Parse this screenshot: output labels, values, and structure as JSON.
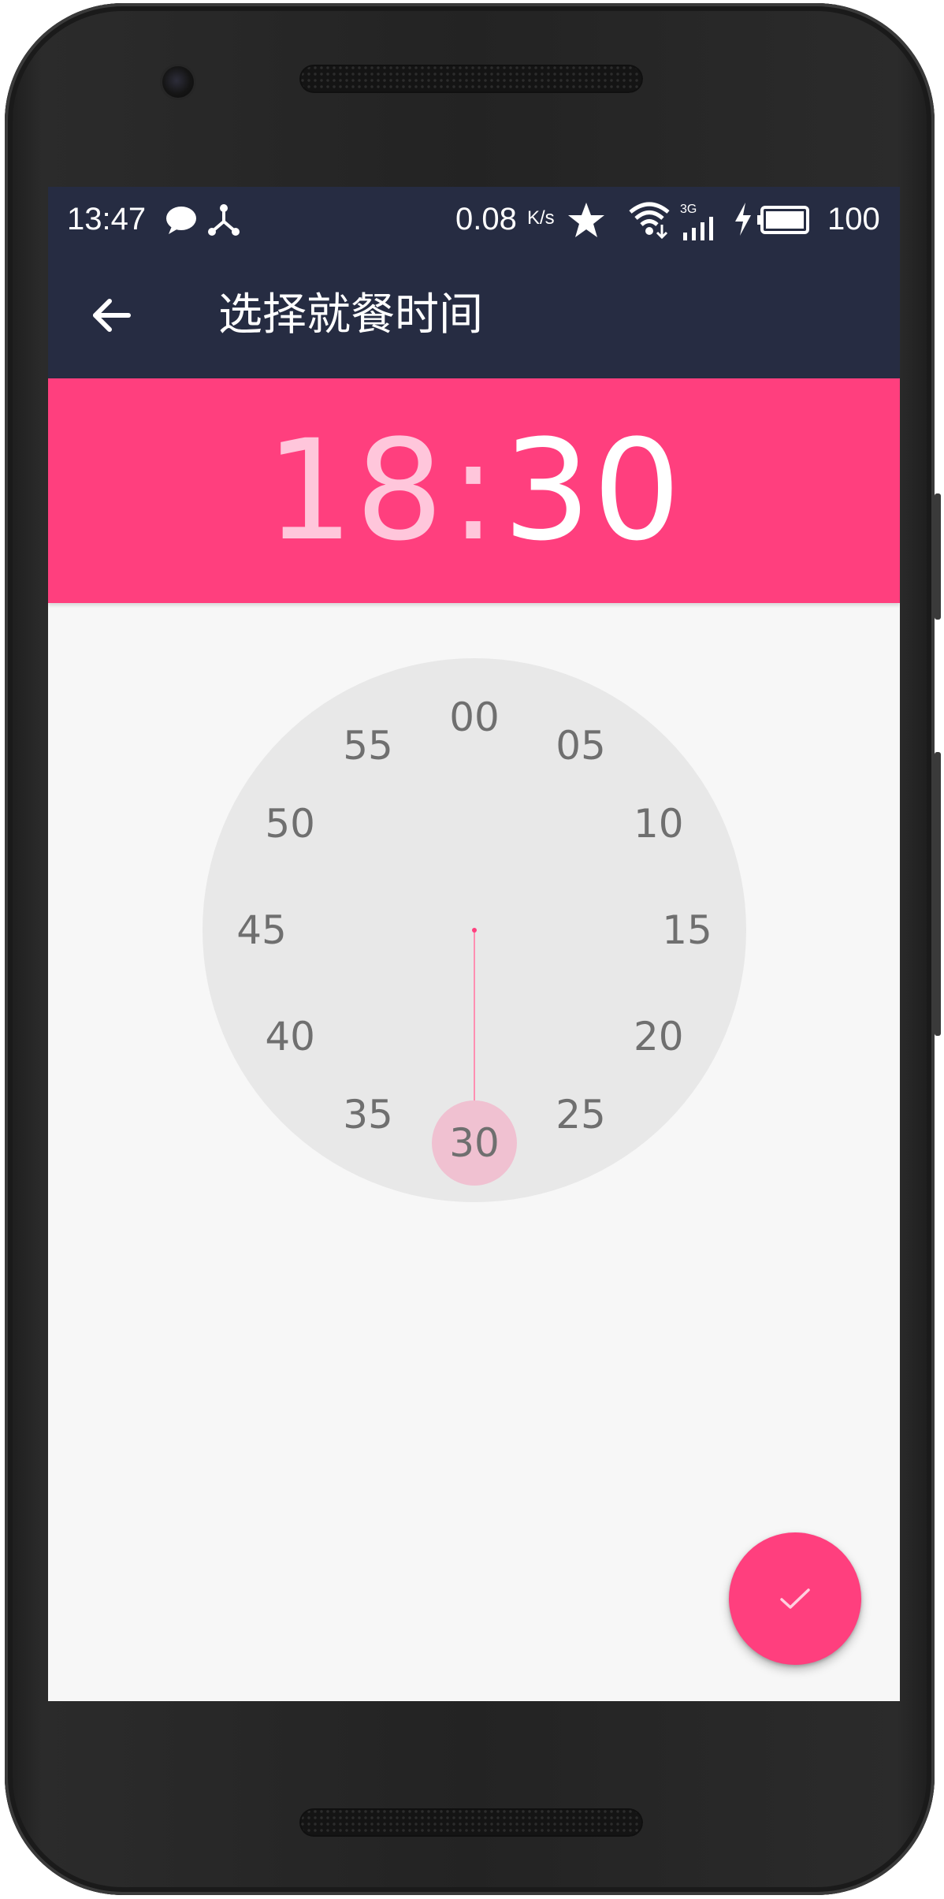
{
  "status_bar": {
    "time": "13:47",
    "speed_value": "0.08",
    "speed_unit": "K/s",
    "network_type": "3G",
    "battery": "100",
    "icons": [
      "chat-bubble-icon",
      "usb-share-icon",
      "star-icon",
      "wifi-icon",
      "signal-icon",
      "charging-icon",
      "battery-icon"
    ]
  },
  "app_bar": {
    "title": "选择就餐时间",
    "back_icon": "arrow-left-icon"
  },
  "time_header": {
    "hour": "18",
    "separator": ":",
    "minute": "30",
    "active_field": "minute"
  },
  "clock": {
    "labels": [
      "00",
      "05",
      "10",
      "15",
      "20",
      "25",
      "30",
      "35",
      "40",
      "45",
      "50",
      "55"
    ],
    "selected": "30"
  },
  "fab": {
    "icon": "check-icon"
  },
  "colors": {
    "app_bar": "#262c42",
    "accent": "#ff3f7e",
    "inactive_time": "#ffc6db",
    "clock_face": "#e8e8e8",
    "clock_selection": "#f0c1d1",
    "clock_hand": "#ff8fb2",
    "clock_number": "#6f6f6f",
    "background": "#f7f7f7"
  }
}
